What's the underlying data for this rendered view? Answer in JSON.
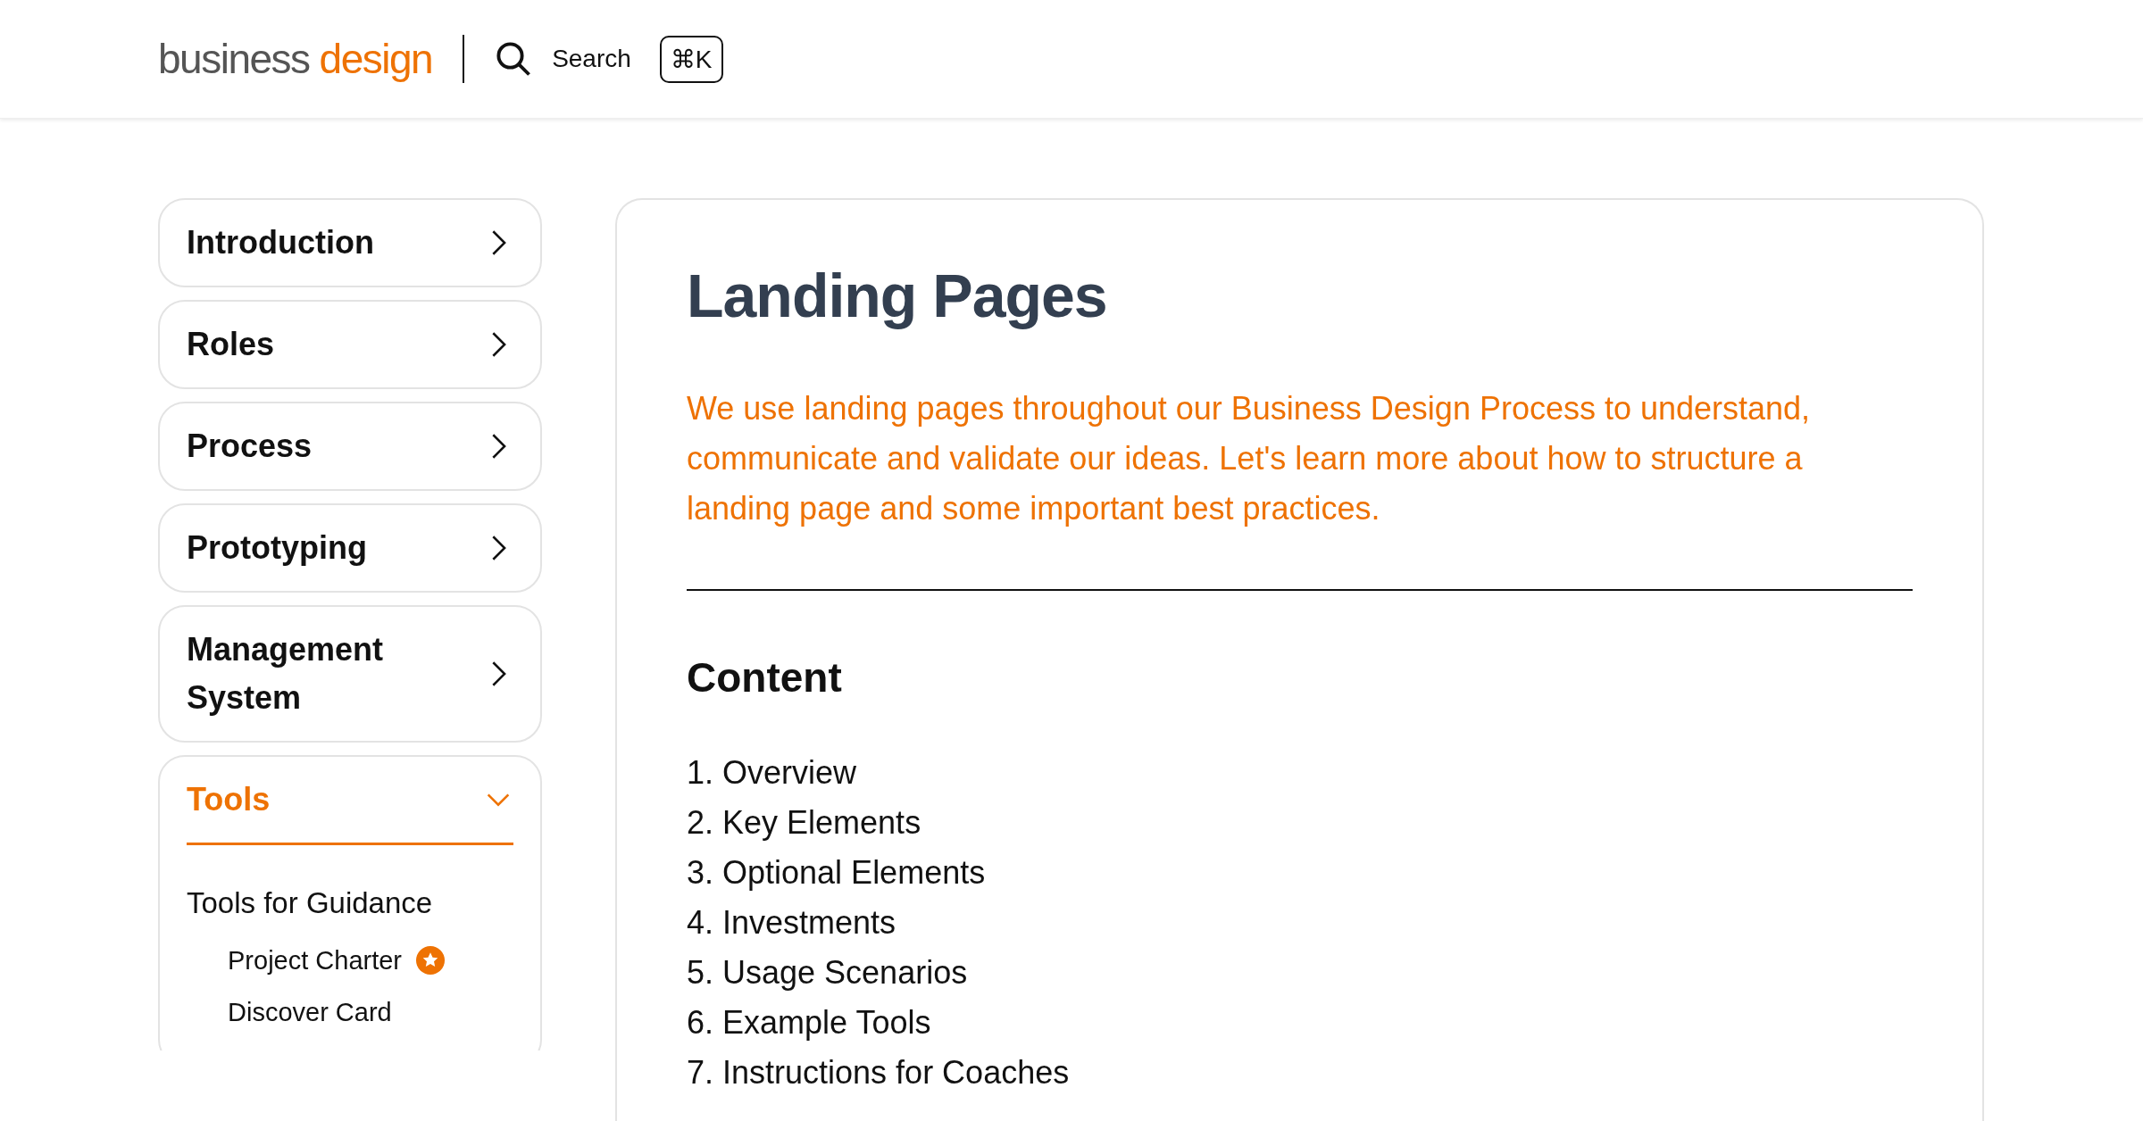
{
  "header": {
    "logo": {
      "part_1": "business",
      "part_2": "design"
    },
    "search": {
      "label": "Search",
      "shortcut": "⌘K"
    }
  },
  "sidebar": {
    "items": [
      {
        "label": "Introduction",
        "expanded": false,
        "selected": false
      },
      {
        "label": "Roles",
        "expanded": false,
        "selected": false
      },
      {
        "label": "Process",
        "expanded": false,
        "selected": false
      },
      {
        "label": "Prototyping",
        "expanded": false,
        "selected": false
      },
      {
        "label": "Management System",
        "expanded": false,
        "selected": false
      },
      {
        "label": "Tools",
        "expanded": true,
        "selected": true,
        "children": [
          {
            "label": "Tools for Guidance",
            "children": [
              {
                "label": "Project Charter",
                "featured": true
              },
              {
                "label": "Discover Card",
                "featured": false
              }
            ]
          }
        ]
      }
    ]
  },
  "article": {
    "title": "Landing Pages",
    "intro": "We use landing pages throughout our Business Design Process to understand, communicate and validate our ideas. Let's learn more about how to structure a landing page and some important best practices.",
    "contents": {
      "heading": "Content",
      "items": [
        "1. Overview",
        "2. Key Elements",
        "3. Optional Elements",
        "4. Investments",
        "5. Usage Scenarios",
        "6. Example Tools",
        "7. Instructions for Coaches"
      ]
    }
  }
}
